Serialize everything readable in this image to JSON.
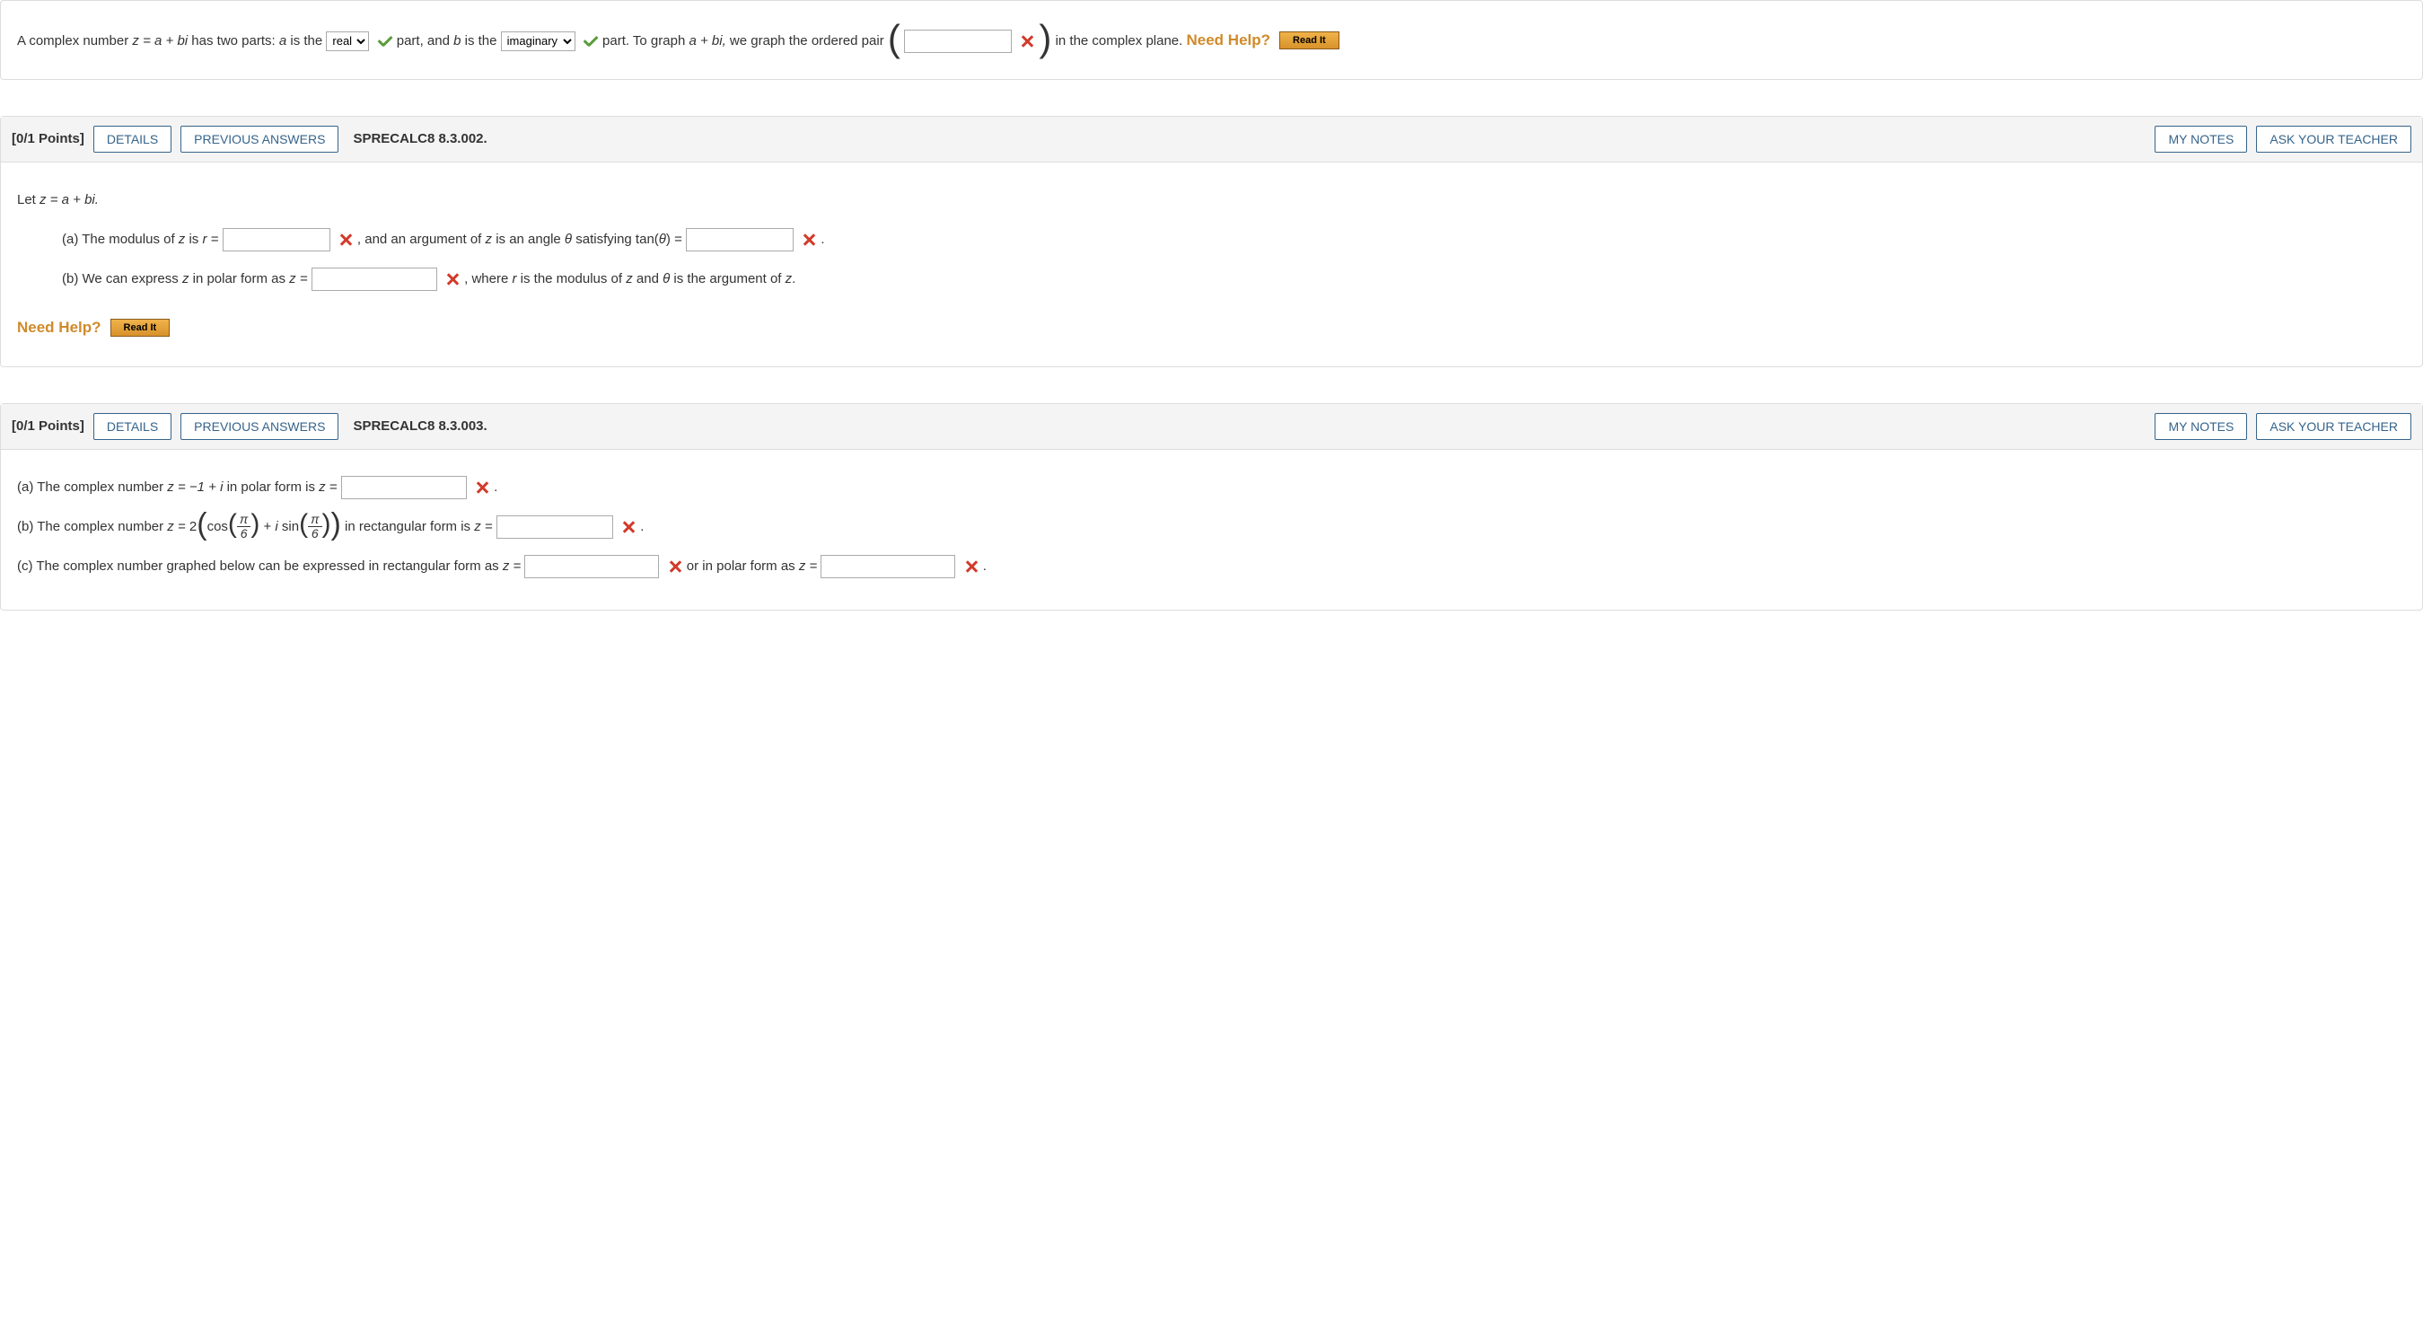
{
  "q1": {
    "text1": "A complex number ",
    "expr1": "z = a + bi",
    "text2": " has two parts: ",
    "a": "a",
    "text3": " is the ",
    "select1": {
      "value": "real",
      "options": [
        "real",
        "imaginary"
      ]
    },
    "text4": " part, and ",
    "b": "b",
    "text5": " is the ",
    "select2": {
      "value": "imaginary",
      "options": [
        "real",
        "imaginary"
      ]
    },
    "text6": " part. To graph ",
    "expr2": "a + bi,",
    "text7": " we graph the ordered pair ",
    "text8": " in the complex plane.",
    "need_help": "Need Help?",
    "read_it": "Read It"
  },
  "q2": {
    "points": "[0/1 Points]",
    "details": "DETAILS",
    "prev": "PREVIOUS ANSWERS",
    "ref": "SPRECALC8 8.3.002.",
    "notes": "MY NOTES",
    "ask": "ASK YOUR TEACHER",
    "intro": "Let ",
    "intro_expr": "z = a + bi.",
    "a_label": "(a) The modulus of ",
    "z": "z",
    "a_text2": " is ",
    "r_eq": "r = ",
    "a_text3": ", and an argument of ",
    "a_text4": " is an angle ",
    "theta": "θ",
    "a_text5": " satisfying tan(",
    "a_text6": ") = ",
    "b_label": "(b) We can express ",
    "b_text2": " in polar form as ",
    "z_eq": "z = ",
    "b_text3": ", where ",
    "r": "r",
    "b_text4": " is the modulus of ",
    "b_text5": " and ",
    "b_text6": " is the argument of ",
    "need_help": "Need Help?",
    "read_it": "Read It"
  },
  "q3": {
    "points": "[0/1 Points]",
    "details": "DETAILS",
    "prev": "PREVIOUS ANSWERS",
    "ref": "SPRECALC8 8.3.003.",
    "notes": "MY NOTES",
    "ask": "ASK YOUR TEACHER",
    "a_text1": "(a) The complex number ",
    "a_expr": "z = −1 + i",
    "a_text2": " in polar form is ",
    "z_eq": "z = ",
    "b_text1": "(b) The complex number ",
    "b_z_eq": "z = ",
    "b_coef": "2",
    "b_cos": "cos",
    "b_plus": " + ",
    "b_i": "i ",
    "b_sin": "sin",
    "b_pi": "π",
    "b_six": "6",
    "b_text2": " in rectangular form is ",
    "c_text1": "(c) The complex number graphed below can be expressed in rectangular form as ",
    "c_text2": " or in polar form as "
  }
}
